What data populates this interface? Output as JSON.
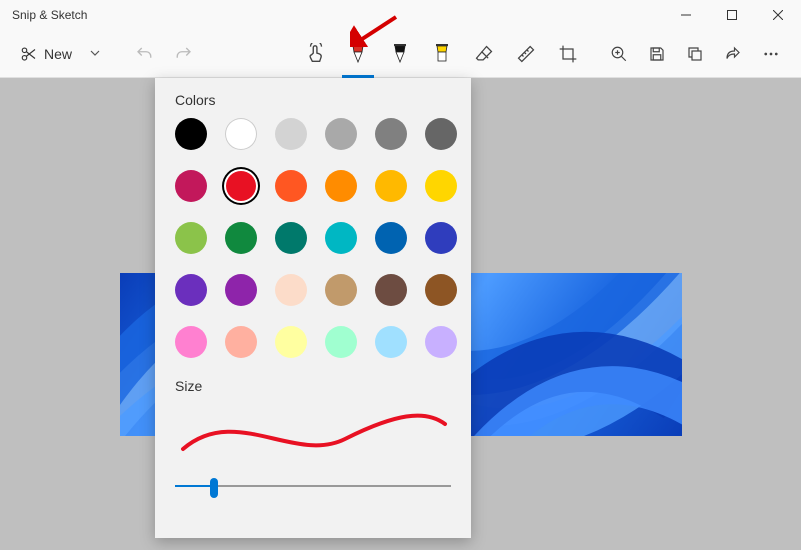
{
  "window": {
    "title": "Snip & Sketch"
  },
  "toolbar": {
    "new_label": "New",
    "tools": [
      {
        "name": "touch-writing",
        "selected": false
      },
      {
        "name": "ballpoint-pen",
        "selected": true,
        "color": "#d93025"
      },
      {
        "name": "pencil",
        "selected": false,
        "color": "#111"
      },
      {
        "name": "highlighter",
        "selected": false,
        "color": "#ffd600"
      },
      {
        "name": "eraser",
        "selected": false
      },
      {
        "name": "ruler",
        "selected": false
      },
      {
        "name": "crop",
        "selected": false
      }
    ],
    "right": [
      "zoom",
      "save",
      "copy",
      "share",
      "more"
    ]
  },
  "popup": {
    "colors_label": "Colors",
    "size_label": "Size",
    "selected_color": "#e81123",
    "colors": [
      "#000000",
      "#ffffff",
      "#d3d3d3",
      "#a9a9a9",
      "#808080",
      "#666666",
      "#c2185b",
      "#e81123",
      "#ff5722",
      "#ff8c00",
      "#ffb900",
      "#ffd600",
      "#8bc34a",
      "#10893e",
      "#00796b",
      "#00b7c3",
      "#0063b1",
      "#2f3dbd",
      "#6b2fbd",
      "#8e24aa",
      "#fcdcc9",
      "#c19a6b",
      "#6d4c41",
      "#8d5524",
      "#ff80d0",
      "#ffb0a0",
      "#ffffa0",
      "#a0ffd0",
      "#a0e0ff",
      "#c8b0ff"
    ],
    "slider": {
      "min": 1,
      "max": 100,
      "value": 14
    }
  },
  "accent": "#0078d4"
}
